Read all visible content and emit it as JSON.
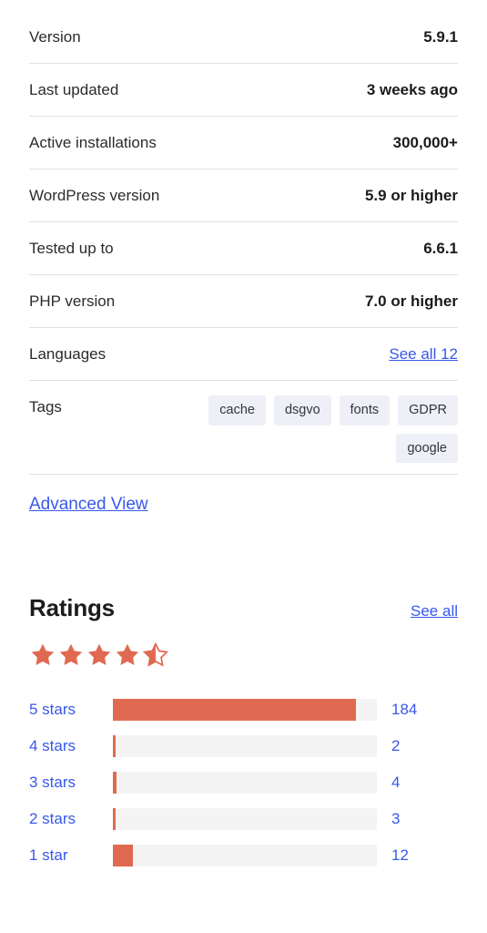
{
  "meta": {
    "rows": [
      {
        "label": "Version",
        "value": "5.9.1",
        "type": "text"
      },
      {
        "label": "Last updated",
        "value": "3 weeks ago",
        "type": "text"
      },
      {
        "label": "Active installations",
        "value": "300,000+",
        "type": "text"
      },
      {
        "label": "WordPress version",
        "value": "5.9 or higher",
        "type": "text"
      },
      {
        "label": "Tested up to",
        "value": "6.6.1",
        "type": "text"
      },
      {
        "label": "PHP version",
        "value": "7.0 or higher",
        "type": "text"
      },
      {
        "label": "Languages",
        "value": "See all 12",
        "type": "link"
      }
    ],
    "tags_label": "Tags",
    "tags": [
      "cache",
      "dsgvo",
      "fonts",
      "GDPR",
      "google"
    ]
  },
  "advanced_view": {
    "label": "Advanced View"
  },
  "ratings": {
    "title": "Ratings",
    "see_all_label": "See all",
    "stars_filled": 4,
    "has_half_star": true,
    "star_icon": "star-icon",
    "half_star_icon": "star-half-icon"
  },
  "chart_data": {
    "type": "bar",
    "title": "Ratings",
    "orientation": "horizontal",
    "categories": [
      "5 stars",
      "4 stars",
      "3 stars",
      "2 stars",
      "1 star"
    ],
    "values": [
      184,
      2,
      4,
      3,
      12
    ],
    "max_value": 200,
    "bar_color": "#e06a51",
    "track_color": "#f4f4f4",
    "label_color": "#3858e9",
    "xlabel": "",
    "ylabel": "",
    "grid": false,
    "legend": "none",
    "bars": [
      {
        "label": "5 stars",
        "count": "184",
        "percent": 92
      },
      {
        "label": "4 stars",
        "count": "2",
        "percent": 1
      },
      {
        "label": "3 stars",
        "count": "4",
        "percent": 1.5
      },
      {
        "label": "2 stars",
        "count": "3",
        "percent": 1.2
      },
      {
        "label": "1 star",
        "count": "12",
        "percent": 7.5
      }
    ]
  },
  "colors": {
    "link": "#3858e9",
    "bar": "#e06a51",
    "chip_bg": "#eeeff7",
    "divider": "#e0e0e0"
  }
}
